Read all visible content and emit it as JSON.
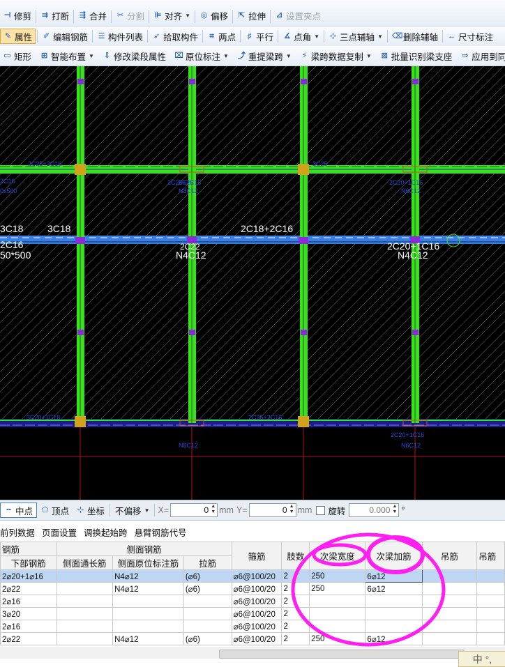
{
  "toolbar1": [
    {
      "name": "trim-button",
      "icon": "trim-icon",
      "glyph": "⊣",
      "label": "修剪",
      "disabled": false
    },
    {
      "name": "break-button",
      "icon": "break-icon",
      "glyph": "⇉",
      "label": "打断",
      "disabled": false
    },
    {
      "name": "merge-button",
      "icon": "merge-icon",
      "glyph": "⇶",
      "label": "合并",
      "disabled": false
    },
    {
      "name": "split-button",
      "icon": "split-icon",
      "glyph": "✂",
      "label": "分割",
      "disabled": true
    },
    {
      "name": "align-button",
      "icon": "align-icon",
      "glyph": "⊫",
      "label": "对齐",
      "disabled": false,
      "dropdown": true
    },
    {
      "name": "offset-button",
      "icon": "offset-icon",
      "glyph": "◎",
      "label": "偏移",
      "disabled": false
    },
    {
      "name": "stretch-button",
      "icon": "stretch-icon",
      "glyph": "⇱",
      "label": "拉伸",
      "disabled": false
    },
    {
      "name": "set-grip-button",
      "icon": "grip-icon",
      "glyph": "⊿",
      "label": "设置夹点",
      "disabled": true
    }
  ],
  "toolbar2": [
    {
      "name": "properties-button",
      "icon": "properties-icon",
      "glyph": "✎",
      "label": "属性",
      "active": true
    },
    {
      "name": "edit-rebar-button",
      "icon": "edit-rebar-icon",
      "glyph": "✐",
      "label": "编辑钢筋"
    },
    {
      "name": "component-list-button",
      "icon": "list-icon",
      "glyph": "☰",
      "label": "构件列表"
    },
    {
      "name": "pick-component-button",
      "icon": "pick-icon",
      "glyph": "➶",
      "label": "拾取构件"
    },
    {
      "name": "two-point-button",
      "icon": "two-point-icon",
      "glyph": "⌗",
      "label": "两点"
    },
    {
      "name": "parallel-button",
      "icon": "parallel-icon",
      "glyph": "♯",
      "label": "平行"
    },
    {
      "name": "point-angle-button",
      "icon": "point-angle-icon",
      "glyph": "∡",
      "label": "点角",
      "dropdown": true
    },
    {
      "name": "three-point-axis-button",
      "icon": "three-point-icon",
      "glyph": "⊹",
      "label": "三点辅轴",
      "dropdown": true
    },
    {
      "name": "delete-axis-button",
      "icon": "delete-axis-icon",
      "glyph": "⌫",
      "label": "删除辅轴"
    },
    {
      "name": "dimension-button",
      "icon": "dimension-icon",
      "glyph": "↔",
      "label": "尺寸标注"
    }
  ],
  "toolbar3": [
    {
      "name": "rectangle-button",
      "icon": "rectangle-icon",
      "glyph": "▭",
      "label": "矩形"
    },
    {
      "name": "smart-layout-button",
      "icon": "smart-layout-icon",
      "glyph": "⊞",
      "label": "智能布置",
      "dropdown": true
    },
    {
      "name": "modify-beam-props-button",
      "icon": "modify-props-icon",
      "glyph": "⇩",
      "label": "修改梁段属性"
    },
    {
      "name": "in-situ-annotation-button",
      "icon": "annotation-icon",
      "glyph": "⌧",
      "label": "原位标注",
      "dropdown": true
    },
    {
      "name": "re-extract-span-button",
      "icon": "extract-icon",
      "glyph": "⤴",
      "label": "重提梁跨",
      "dropdown": true
    },
    {
      "name": "copy-span-data-button",
      "icon": "copy-icon",
      "glyph": "⚡",
      "label": "梁跨数据复制",
      "dropdown": true
    },
    {
      "name": "batch-identify-support-button",
      "icon": "identify-icon",
      "glyph": "⊠",
      "label": "批量识别梁支座"
    },
    {
      "name": "apply-to-same-button",
      "icon": "apply-icon",
      "glyph": "⇨",
      "label": "应用到同"
    }
  ],
  "canvas_labels": [
    {
      "text": "3C18",
      "size": 14,
      "color": "#ffffff"
    },
    {
      "text": "3C18",
      "size": 14,
      "color": "#ffffff"
    },
    {
      "text": "2C16",
      "size": 14,
      "color": "#ffffff"
    },
    {
      "text": "50*500",
      "size": 14,
      "color": "#ffffff"
    },
    {
      "text": "2C18+2C16",
      "size": 14,
      "color": "#ffffff"
    },
    {
      "text": "2C22",
      "size": 12,
      "color": "#ffffff"
    },
    {
      "text": "N4C12",
      "size": 14,
      "color": "#ffffff"
    },
    {
      "text": "2C20+1C16",
      "size": 14,
      "color": "#ffffff"
    },
    {
      "text": "N4C12",
      "size": 14,
      "color": "#ffffff"
    },
    {
      "text": "2C25+2C16",
      "size": 9,
      "color": "#2d46d9"
    },
    {
      "text": "2C25+2C16",
      "size": 9,
      "color": "#2d46d9"
    },
    {
      "text": "2C16",
      "size": 9,
      "color": "#2d46d9"
    },
    {
      "text": "0x500",
      "size": 9,
      "color": "#2d46d9"
    },
    {
      "text": "2C25",
      "size": 9,
      "color": "#2d46d9"
    },
    {
      "text": "N8C12",
      "size": 9,
      "color": "#2d46d9"
    },
    {
      "text": "2C20+1C16",
      "size": 9,
      "color": "#2d46d9"
    },
    {
      "text": "N6C12",
      "size": 9,
      "color": "#2d46d9"
    },
    {
      "text": "2C25+2C16",
      "size": 9,
      "color": "#2d46d9"
    },
    {
      "text": "N8C12",
      "size": 9,
      "color": "#2d46d9"
    },
    {
      "text": "2C20+1C16",
      "size": 9,
      "color": "#2d46d9"
    },
    {
      "text": "N6C12",
      "size": 9,
      "color": "#2d46d9"
    },
    {
      "text": "3C25",
      "size": 9,
      "color": "#2d46d9"
    },
    {
      "text": "3C20+1C18",
      "size": 9,
      "color": "#2d46d9"
    }
  ],
  "statusbar": {
    "midpoint_label": "中点",
    "vertex_label": "顶点",
    "coord_label": "坐标",
    "offset_option": "不偏移",
    "x_label": "X=",
    "x_value": "0",
    "y_label": "Y=",
    "y_value": "0",
    "mm_label": "mm",
    "rotate_label": "旋转",
    "rotate_value": "0.000",
    "degree_label": "°"
  },
  "menubar": {
    "items": [
      "前列数据",
      "页面设置",
      "调换起始跨",
      "悬臂钢筋代号"
    ],
    "visible_fragments": [
      "前列数据"
    ]
  },
  "table": {
    "group_headers": {
      "rebar": "钢筋",
      "side_rebar": "侧面钢筋"
    },
    "columns": [
      "下部钢筋",
      "侧面通长筋",
      "侧面原位标注筋",
      "拉筋",
      "箍筋",
      "肢数",
      "次梁宽度",
      "次梁加筋",
      "吊筋",
      "吊筋"
    ],
    "rows": [
      [
        "2⌀20+1⌀16",
        "",
        "N4⌀12",
        "(⌀6)",
        "⌀6@100/20",
        "2",
        "250",
        "6⌀12",
        "",
        ""
      ],
      [
        "2⌀22",
        "",
        "N4⌀12",
        "(⌀6)",
        "⌀6@100/20",
        "2",
        "250",
        "6⌀12",
        "",
        ""
      ],
      [
        "2⌀16",
        "",
        "",
        "",
        "⌀6@100/20",
        "2",
        "",
        "",
        "",
        ""
      ],
      [
        "3⌀20",
        "",
        "",
        "",
        "⌀6@100/20",
        "2",
        "",
        "",
        "",
        ""
      ],
      [
        "2⌀16",
        "",
        "",
        "",
        "⌀6@100/20",
        "2",
        "",
        "",
        "",
        ""
      ],
      [
        "2⌀22",
        "",
        "N4⌀12",
        "(⌀6)",
        "⌀6@100/20",
        "2",
        "250",
        "6⌀12",
        "",
        ""
      ]
    ],
    "selected_row": 0
  },
  "ime": {
    "text": "中 °,"
  },
  "colors": {
    "beam": "#39e01e",
    "beam_blue": "#3a7fe0",
    "highlight_ring": "#ff1ff0",
    "canvas_bg": "#000000",
    "column": "#d3a21a"
  }
}
